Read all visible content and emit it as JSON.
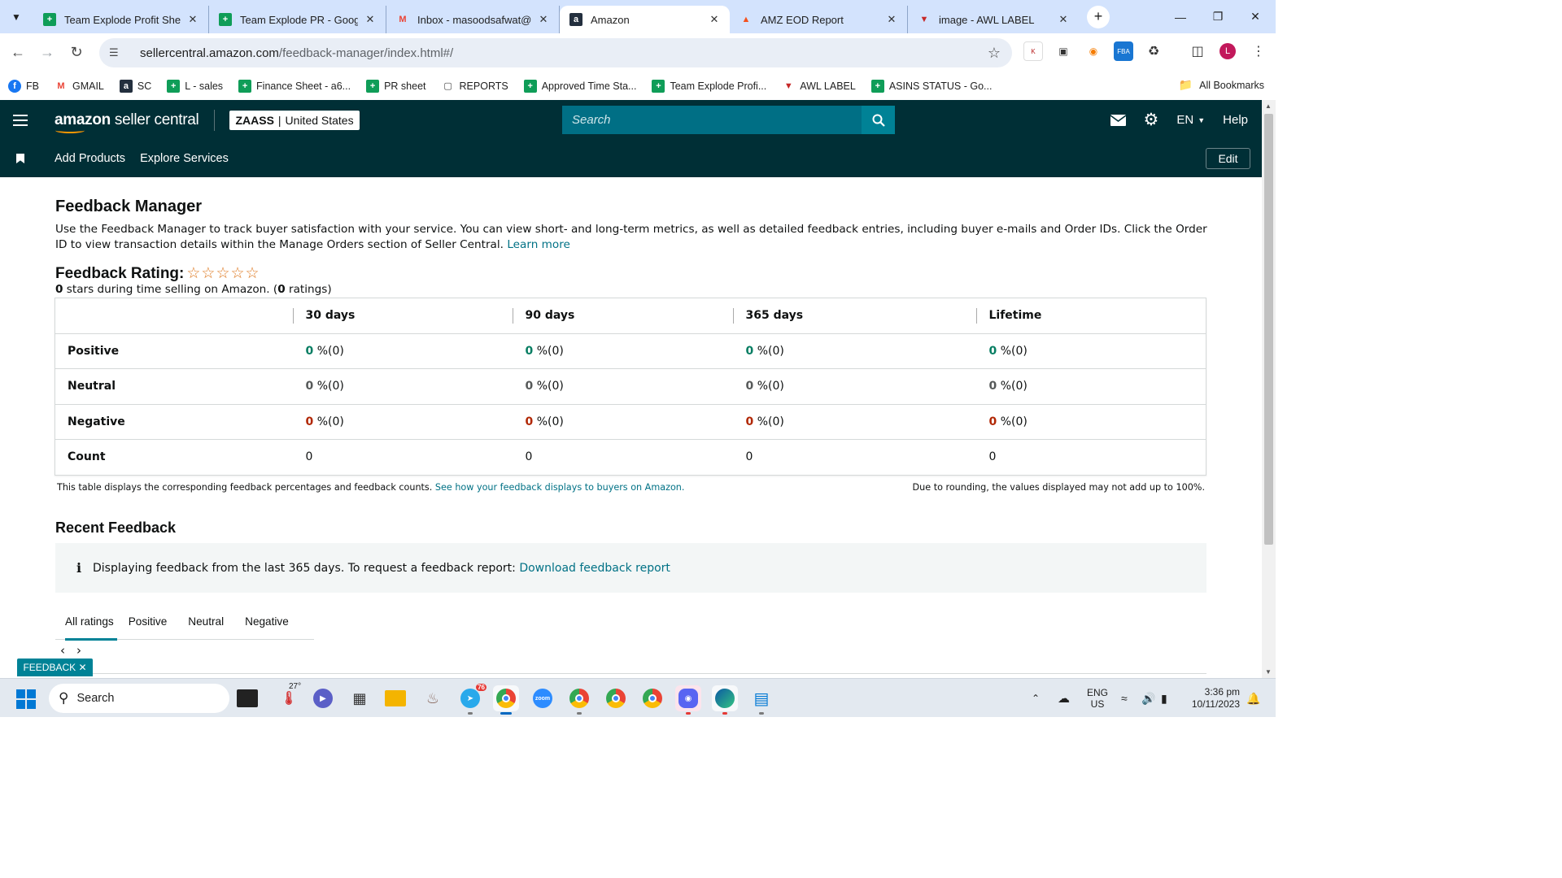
{
  "browser": {
    "tabs": [
      {
        "title": "Team Explode Profit Sheet",
        "icon": "sheets-icon",
        "color": "#0f9d58"
      },
      {
        "title": "Team Explode PR - Google",
        "icon": "sheets-icon",
        "color": "#0f9d58"
      },
      {
        "title": "Inbox - masoodsafwat@gm",
        "icon": "gmail-icon",
        "color": "#ea4335"
      },
      {
        "title": "Amazon",
        "icon": "amazon-icon",
        "color": "#232f3e"
      },
      {
        "title": "AMZ EOD Report",
        "icon": "report-icon",
        "color": "#f4511e"
      },
      {
        "title": "image - AWL LABEL",
        "icon": "awl-icon",
        "color": "#c62828"
      }
    ],
    "active_tab": 3,
    "url_host": "sellercentral.amazon.com",
    "url_path": "/feedback-manager/index.html#/",
    "bookmarks": [
      {
        "label": "FB",
        "icon": "facebook-icon",
        "color": "#1877f2"
      },
      {
        "label": "GMAIL",
        "icon": "gmail-icon",
        "color": "#ea4335"
      },
      {
        "label": "SC",
        "icon": "amazon-icon",
        "color": "#232f3e"
      },
      {
        "label": "L - sales",
        "icon": "sheets-icon",
        "color": "#0f9d58"
      },
      {
        "label": "Finance Sheet - a6...",
        "icon": "sheets-icon",
        "color": "#0f9d58"
      },
      {
        "label": "PR sheet",
        "icon": "sheets-icon",
        "color": "#0f9d58"
      },
      {
        "label": "REPORTS",
        "icon": "folder-icon",
        "color": "#474747"
      },
      {
        "label": "Approved Time Sta...",
        "icon": "sheets-icon",
        "color": "#0f9d58"
      },
      {
        "label": "Team Explode Profi...",
        "icon": "sheets-icon",
        "color": "#0f9d58"
      },
      {
        "label": "AWL LABEL",
        "icon": "awl-icon",
        "color": "#c62828"
      },
      {
        "label": "ASINS STATUS - Go...",
        "icon": "sheets-icon",
        "color": "#0f9d58"
      }
    ],
    "all_bookmarks": "All Bookmarks",
    "profile_initial": "L"
  },
  "seller_central": {
    "logo_text_bold": "amazon",
    "logo_text": " seller central",
    "account_name": "ZAASS",
    "account_region": "United States",
    "search_placeholder": "Search",
    "language": "EN",
    "help": "Help",
    "subnav": [
      "Add Products",
      "Explore Services"
    ],
    "edit": "Edit"
  },
  "page": {
    "title": "Feedback Manager",
    "intro": "Use the Feedback Manager to track buyer satisfaction with your service. You can view short- and long-term metrics, as well as detailed feedback entries, including buyer e-mails and Order IDs. Click the Order ID to view transaction details within the Manage Orders section of Seller Central.",
    "learn_more": "Learn more",
    "rating_label": "Feedback Rating:",
    "stars": "☆☆☆☆☆",
    "rating_value": "0",
    "rating_value_text": " stars during time selling on Amazon. (",
    "rating_count": "0",
    "rating_count_text": " ratings)",
    "table": {
      "headers": [
        "",
        "30 days",
        "90 days",
        "365 days",
        "Lifetime"
      ],
      "rows": [
        {
          "label": "Positive",
          "kind": "pos",
          "cells": [
            {
              "v": "0",
              "t": " %(0)"
            },
            {
              "v": "0",
              "t": " %(0)"
            },
            {
              "v": "0",
              "t": " %(0)"
            },
            {
              "v": "0",
              "t": " %(0)"
            }
          ]
        },
        {
          "label": "Neutral",
          "kind": "neu",
          "cells": [
            {
              "v": "0",
              "t": " %(0)"
            },
            {
              "v": "0",
              "t": " %(0)"
            },
            {
              "v": "0",
              "t": " %(0)"
            },
            {
              "v": "0",
              "t": " %(0)"
            }
          ]
        },
        {
          "label": "Negative",
          "kind": "neg",
          "cells": [
            {
              "v": "0",
              "t": " %(0)"
            },
            {
              "v": "0",
              "t": " %(0)"
            },
            {
              "v": "0",
              "t": " %(0)"
            },
            {
              "v": "0",
              "t": " %(0)"
            }
          ]
        },
        {
          "label": "Count",
          "kind": "count",
          "cells": [
            {
              "v": "",
              "t": "0"
            },
            {
              "v": "",
              "t": "0"
            },
            {
              "v": "",
              "t": "0"
            },
            {
              "v": "",
              "t": "0"
            }
          ]
        }
      ]
    },
    "table_note": "This table displays the corresponding feedback percentages and feedback counts.",
    "table_note_link": "See how your feedback displays to buyers on Amazon.",
    "rounding_note": "Due to rounding, the values displayed may not add up to 100%.",
    "recent_title": "Recent Feedback",
    "info_text": "Displaying feedback from the last 365 days. To request a feedback report:",
    "info_link": "Download feedback report",
    "filter_tabs": [
      "All ratings",
      "Positive",
      "Neutral",
      "Negative"
    ],
    "active_filter": 0,
    "feedback_button": "FEEDBACK ✕"
  },
  "taskbar": {
    "search": "Search",
    "weather_temp": "27°",
    "telegram_badge": "76",
    "lang_line1": "ENG",
    "lang_line2": "US",
    "time": "3:36 pm",
    "date": "10/11/2023"
  },
  "colors": {
    "header_bg": "#002f36",
    "search_bg": "#006f85",
    "accent_teal": "#008296",
    "link": "#007185",
    "positive": "#067d62",
    "negative": "#b12704",
    "browser_frame": "#d3e3fd"
  }
}
